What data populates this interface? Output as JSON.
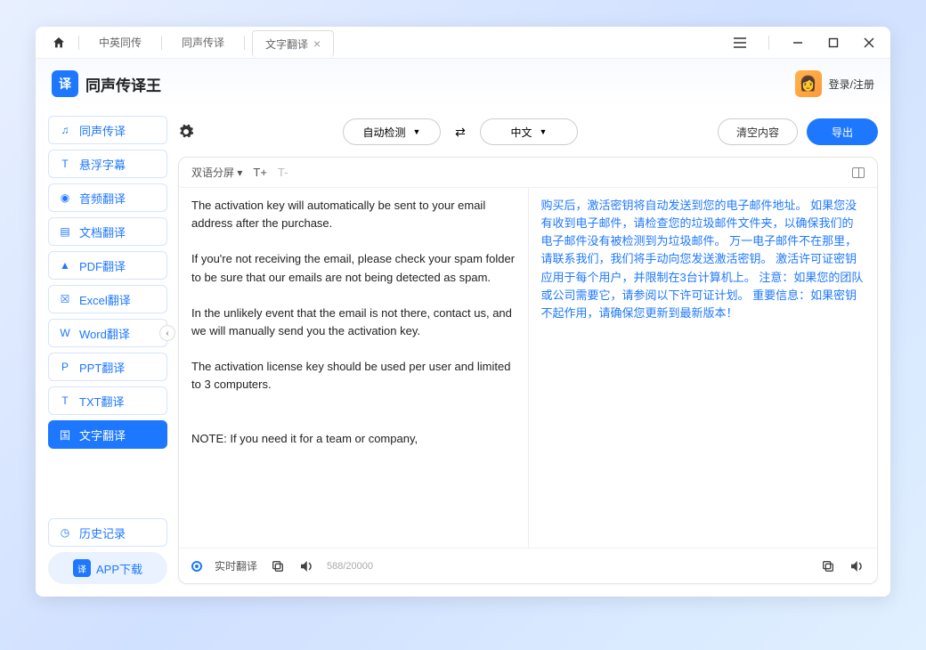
{
  "titlebar": {
    "tabs": [
      {
        "label": "中英同传",
        "active": false
      },
      {
        "label": "同声传译",
        "active": false
      },
      {
        "label": "文字翻译",
        "active": true
      }
    ]
  },
  "header": {
    "brand": "同声传译王",
    "login": "登录/注册"
  },
  "sidebar": {
    "items": [
      {
        "label": "同声传译",
        "icon": "headset"
      },
      {
        "label": "悬浮字幕",
        "icon": "subtitle"
      },
      {
        "label": "音频翻译",
        "icon": "audio"
      },
      {
        "label": "文档翻译",
        "icon": "doc"
      },
      {
        "label": "PDF翻译",
        "icon": "pdf"
      },
      {
        "label": "Excel翻译",
        "icon": "excel"
      },
      {
        "label": "Word翻译",
        "icon": "word",
        "chevron": true
      },
      {
        "label": "PPT翻译",
        "icon": "ppt"
      },
      {
        "label": "TXT翻译",
        "icon": "txt"
      },
      {
        "label": "文字翻译",
        "icon": "text",
        "active": true
      }
    ],
    "history": "历史记录",
    "app_download": "APP下载"
  },
  "toolbar": {
    "source_lang": "自动检测",
    "target_lang": "中文",
    "clear": "清空内容",
    "export": "导出"
  },
  "card": {
    "view_mode": "双语分屏",
    "realtime_label": "实时翻译",
    "counter": "588/20000",
    "source_text": "The activation key will automatically be sent to your email address after the purchase.\n\nIf you're not receiving the email, please check your spam folder to be sure that our emails are not being detected as spam.\n\nIn the unlikely event that the email is not there, contact us, and we will manually send you the activation key.\n\nThe activation license key should be used per user and limited to 3 computers.\n\n\nNOTE: If you need it for a team or company,",
    "target_text": "购买后，激活密钥将自动发送到您的电子邮件地址。 如果您没有收到电子邮件，请检查您的垃圾邮件文件夹，以确保我们的电子邮件没有被检测到为垃圾邮件。 万一电子邮件不在那里，请联系我们，我们将手动向您发送激活密钥。 激活许可证密钥应用于每个用户，并限制在3台计算机上。 注意：如果您的团队或公司需要它，请参阅以下许可证计划。 重要信息：如果密钥不起作用，请确保您更新到最新版本！"
  }
}
